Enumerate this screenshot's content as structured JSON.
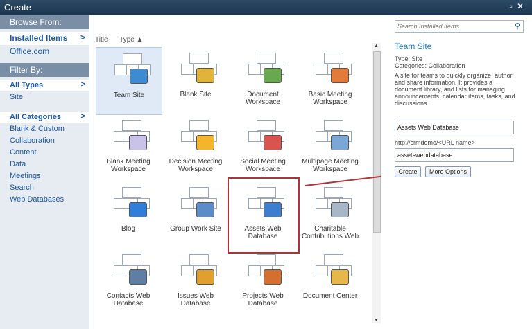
{
  "window": {
    "title": "Create"
  },
  "sidebar": {
    "browse_from": "Browse From:",
    "browse_items": [
      {
        "label": "Installed Items"
      },
      {
        "label": "Office.com"
      }
    ],
    "filter_by": "Filter By:",
    "type_items": [
      {
        "label": "All Types"
      },
      {
        "label": "Site"
      }
    ],
    "category_items": [
      {
        "label": "All Categories"
      },
      {
        "label": "Blank & Custom"
      },
      {
        "label": "Collaboration"
      },
      {
        "label": "Content"
      },
      {
        "label": "Data"
      },
      {
        "label": "Meetings"
      },
      {
        "label": "Search"
      },
      {
        "label": "Web Databases"
      }
    ]
  },
  "list_header": {
    "title": "Title",
    "type": "Type ▲"
  },
  "tiles": [
    {
      "label": "Team Site",
      "icon": "team-site-icon"
    },
    {
      "label": "Blank Site",
      "icon": "blank-site-icon"
    },
    {
      "label": "Document Workspace",
      "icon": "document-workspace-icon"
    },
    {
      "label": "Basic Meeting Workspace",
      "icon": "basic-meeting-workspace-icon"
    },
    {
      "label": "Blank Meeting Workspace",
      "icon": "blank-meeting-workspace-icon"
    },
    {
      "label": "Decision Meeting Workspace",
      "icon": "decision-meeting-workspace-icon"
    },
    {
      "label": "Social Meeting Workspace",
      "icon": "social-meeting-workspace-icon"
    },
    {
      "label": "Multipage Meeting Workspace",
      "icon": "multipage-meeting-workspace-icon"
    },
    {
      "label": "Blog",
      "icon": "blog-icon"
    },
    {
      "label": "Group Work Site",
      "icon": "group-work-site-icon"
    },
    {
      "label": "Assets Web Database",
      "icon": "assets-web-database-icon"
    },
    {
      "label": "Charitable Contributions Web",
      "icon": "charitable-contributions-icon"
    },
    {
      "label": "Contacts Web Database",
      "icon": "contacts-web-database-icon"
    },
    {
      "label": "Issues Web Database",
      "icon": "issues-web-database-icon"
    },
    {
      "label": "Projects Web Database",
      "icon": "projects-web-database-icon"
    },
    {
      "label": "Document Center",
      "icon": "document-center-icon"
    }
  ],
  "details": {
    "search_placeholder": "Search Installed Items",
    "title": "Team Site",
    "type_line": "Type: Site",
    "categories_line": "Categories: Collaboration",
    "description": "A site for teams to quickly organize, author, and share information. It provides a document library, and lists for managing announcements, calendar items, tasks, and discussions.",
    "name_value": "Assets Web Database",
    "url_label": "http://crmdemo/<URL name>",
    "url_value": "assetswebdatabase",
    "create_label": "Create",
    "more_options_label": "More Options"
  },
  "colors": {
    "accent": "#1b58a5",
    "highlight_box": "#b0323a",
    "titlebar": "#1b3550"
  }
}
